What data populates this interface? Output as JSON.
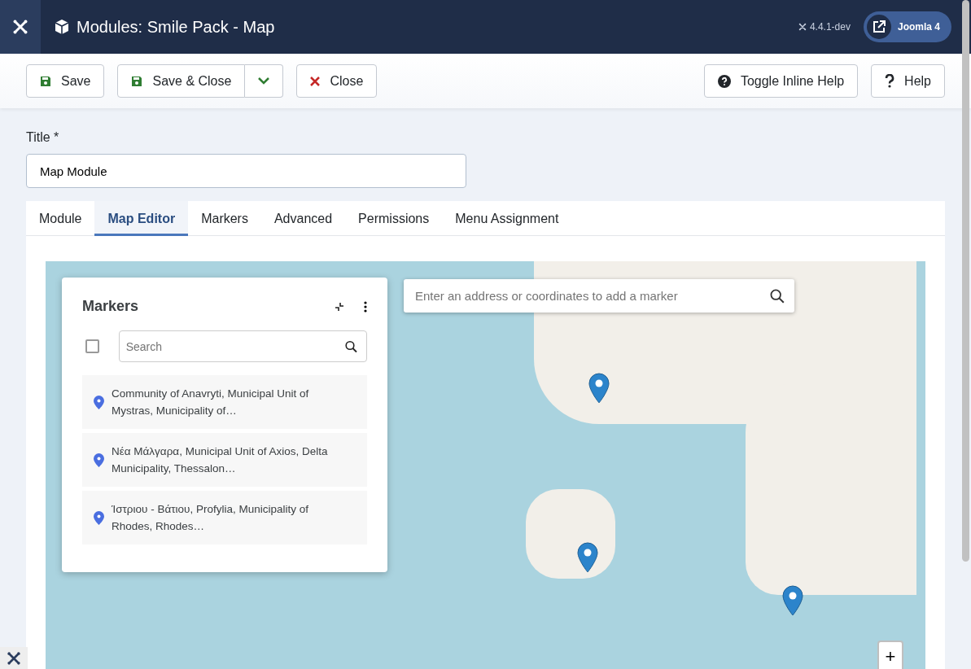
{
  "header": {
    "title": "Modules: Smile Pack - Map",
    "version": "4.4.1-dev",
    "site_link": "Joomla 4"
  },
  "toolbar": [
    {
      "kind": "save",
      "label": "Save"
    },
    {
      "kind": "save-close",
      "label": "Save & Close"
    },
    {
      "kind": "close",
      "label": "Close"
    },
    {
      "kind": "inline-help",
      "label": "Toggle Inline Help"
    },
    {
      "kind": "help",
      "label": "Help"
    }
  ],
  "title_field": {
    "label": "Title *",
    "value": "Map Module"
  },
  "tabs": [
    {
      "label": "Module",
      "selected": false
    },
    {
      "label": "Map Editor",
      "selected": true
    },
    {
      "label": "Markers",
      "selected": false
    },
    {
      "label": "Advanced",
      "selected": false
    },
    {
      "label": "Permissions",
      "selected": false
    },
    {
      "label": "Menu Assignment",
      "selected": false
    }
  ],
  "map": {
    "address_search": {
      "placeholder": "Enter an address or coordinates to add a marker"
    },
    "zoom_in": "+",
    "markers_panel": {
      "title": "Markers",
      "select_all": {
        "checked": false
      },
      "search": {
        "placeholder": "Search"
      },
      "items": [
        {
          "text": "Community of Anavryti, Municipal Unit of Mystras, Municipality of…"
        },
        {
          "text": "Νέα Μάλγαρα, Municipal Unit of Axios, Delta Municipality, Thessalon…"
        },
        {
          "text": "Ίστριου - Βάτιου, Profylia, Municipality of Rhodes, Rhodes…"
        }
      ]
    }
  }
}
